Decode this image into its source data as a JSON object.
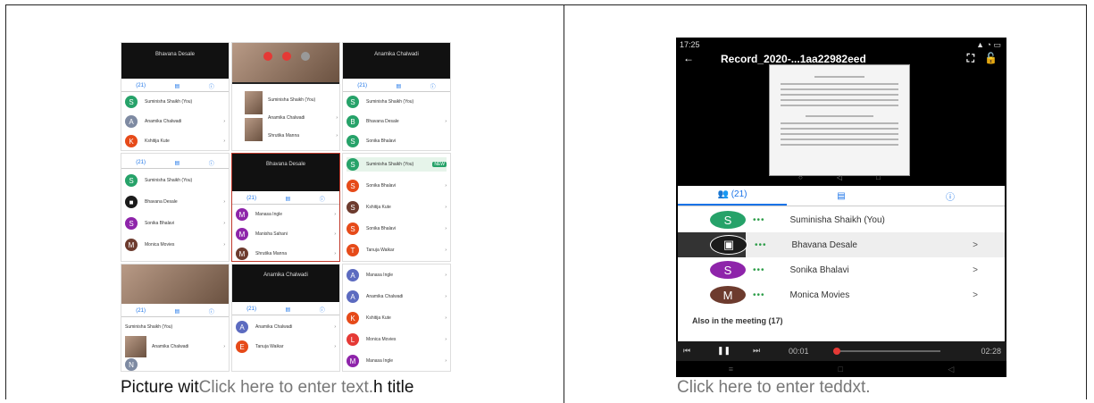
{
  "captions": {
    "left_dark_1": "Picture wit",
    "left_gray": "Click here to enter text.",
    "left_dark_2": "h title",
    "right": "Click here to enter teddxt."
  },
  "phone": {
    "status_time": "17:25",
    "title": "Record_2020-...1aa22982eed",
    "tabs": {
      "people": "(21)"
    },
    "participants": [
      {
        "initial": "S",
        "name": "Suminisha Shaikh (You)",
        "color": "#26a269"
      },
      {
        "initial": "",
        "name": "Bhavana Desale",
        "color": "#1b1b1b"
      },
      {
        "initial": "S",
        "name": "Sonika Bhalavi",
        "color": "#8e24aa"
      },
      {
        "initial": "M",
        "name": "Monica Movies",
        "color": "#6d3b2e"
      }
    ],
    "also_label": "Also in the meeting (17)",
    "time_elapsed": "00:01",
    "time_total": "02:28"
  },
  "collage": {
    "names": {
      "bhavana": "Bhavana Desale",
      "anamika": "Anamika Chalwadi",
      "suminisha": "Suminisha Shaikh (You)",
      "anamika2": "Anamika Chalwadi",
      "kshitija": "Kshitija Kute",
      "bhavana2": "Bhavana Desale",
      "sonika": "Sonika Bhalavi",
      "monica": "Monica Movies",
      "manasa": "Manasa Ingle",
      "manisha": "Manisha Sahani",
      "shrutika": "Shrutika Manna",
      "tanuja": "Tanuja Waikar",
      "new_badge": "NEW",
      "people_tab": "(21)"
    }
  }
}
